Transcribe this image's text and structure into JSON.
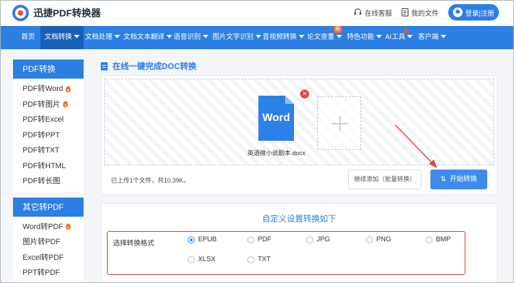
{
  "header": {
    "brand": "迅捷PDF转换器",
    "support_label": "在线客服",
    "files_label": "我的文件",
    "login_label": "登录|注册"
  },
  "nav": {
    "items": [
      {
        "label": "首页"
      },
      {
        "label": "文档转换"
      },
      {
        "label": "文档处理"
      },
      {
        "label": "文档文本翻译"
      },
      {
        "label": "语音识别"
      },
      {
        "label": "图片文字识别"
      },
      {
        "label": "音视频转换"
      },
      {
        "label": "论文查重"
      },
      {
        "label": "特色功能"
      },
      {
        "label": "AI工具"
      },
      {
        "label": "客户端"
      }
    ],
    "new_badge": "新"
  },
  "sidebar": {
    "group1": {
      "title": "PDF转换",
      "items": [
        {
          "label": "PDF转Word"
        },
        {
          "label": "PDF转图片"
        },
        {
          "label": "PDF转Excel"
        },
        {
          "label": "PDF转PPT"
        },
        {
          "label": "PDF转TXT"
        },
        {
          "label": "PDF转HTML"
        },
        {
          "label": "PDF转长图"
        }
      ]
    },
    "group2": {
      "title": "其它转PDF",
      "items": [
        {
          "label": "Word转PDF"
        },
        {
          "label": "图片转PDF"
        },
        {
          "label": "Excel转PDF"
        },
        {
          "label": "PPT转PDF"
        }
      ]
    }
  },
  "main": {
    "title": "在线一键完成DOC转换",
    "file": {
      "icon_text": "Word",
      "name": "英语微小说剧本.docx"
    },
    "status": "已上传1个文件，共10.39K。",
    "batch_button": "继续添加（批量转换）",
    "convert_button": "开始转换"
  },
  "settings": {
    "title": "自定义设置转换如下",
    "format_label": "选择转换格式",
    "formats": [
      {
        "label": "EPUB"
      },
      {
        "label": "PDF"
      },
      {
        "label": "JPG"
      },
      {
        "label": "PNG"
      },
      {
        "label": "BMP"
      },
      {
        "label": "XLSX"
      },
      {
        "label": "TXT"
      }
    ],
    "selected": "EPUB"
  },
  "colors": {
    "primary": "#2d7fe3",
    "nav_active": "#1a5fb8",
    "highlight_box": "#d9353b",
    "arrow": "#e8453c"
  }
}
